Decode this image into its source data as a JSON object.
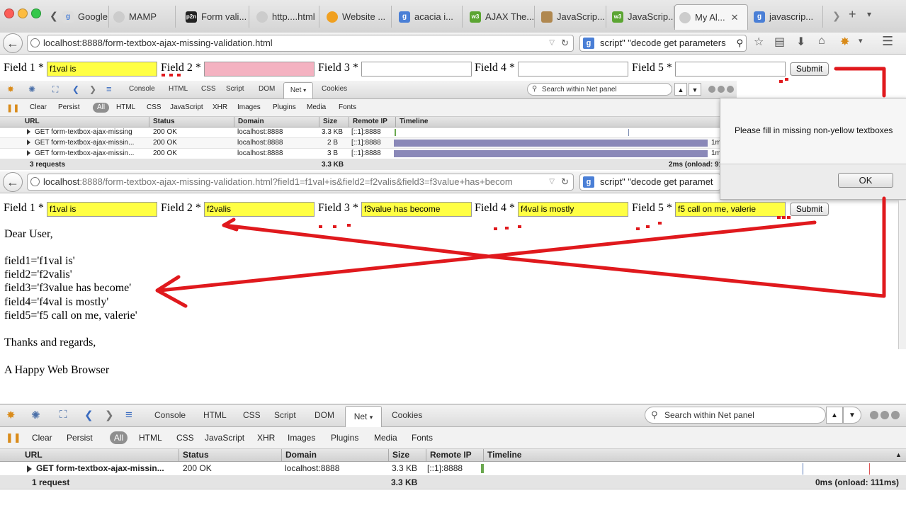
{
  "colors": {
    "yellow": "#ffff44",
    "pink": "#f4b2c1",
    "annotation_red": "#e0191d",
    "timeline_bar": "#8a88b8"
  },
  "tabs": [
    {
      "label": "Google T...",
      "icon": "google-icon"
    },
    {
      "label": "MAMP",
      "icon": "globe-icon"
    },
    {
      "label": "Form vali...",
      "icon": "p2n-icon"
    },
    {
      "label": "http....html",
      "icon": "globe-icon"
    },
    {
      "label": "Website ...",
      "icon": "sun-icon"
    },
    {
      "label": "acacia i...",
      "icon": "google-icon"
    },
    {
      "label": "AJAX The...",
      "icon": "w3-icon"
    },
    {
      "label": "JavaScrip...",
      "icon": "javascript-icon"
    },
    {
      "label": "JavaScrip...",
      "icon": "w3-icon"
    },
    {
      "label": "My Al...",
      "icon": "globe-icon"
    },
    {
      "label": "javascrip...",
      "icon": "google-icon"
    }
  ],
  "tab_bar": {
    "p2n": "p2n",
    "w3": "w3",
    "g": "g",
    "close": "✕",
    "scroll_right": "❯",
    "new_tab": "+",
    "menu": "▾",
    "scroll_left": "❮"
  },
  "nav": {
    "url": "localhost:8888/form-textbox-ajax-missing-validation.html",
    "search": "script\" \"decode get parameters",
    "search_engine": "g",
    "icons": [
      "star-icon",
      "reading-list-icon",
      "download-icon",
      "home-icon",
      "firebug-icon",
      "menu-icon"
    ]
  },
  "inner_nav": {
    "url_host": "localhost",
    "url_rest": ":8888/form-textbox-ajax-missing-validation.html?field1=f1val+is&field2=f2valis&field3=f3value+has+becom",
    "search": "script\" \"decode get paramet"
  },
  "form_top": {
    "labels": [
      "Field 1 *",
      "Field 2 *",
      "Field 3 *",
      "Field 4 *",
      "Field 5 *"
    ],
    "values": [
      "f1val is",
      "",
      "",
      "",
      ""
    ],
    "submit": "Submit"
  },
  "form_bottom": {
    "labels": [
      "Field 1 *",
      "Field 2 *",
      "Field 3 *",
      "Field 4 *",
      "Field 5 *"
    ],
    "values": [
      "f1val  is",
      "f2valis",
      "f3value  has  become",
      "f4val  is  mostly",
      "f5  call  on  me,  valerie"
    ],
    "submit": "Submit"
  },
  "alert": {
    "message": "Please fill in missing non-yellow textboxes",
    "ok": "OK"
  },
  "letter": {
    "greeting": "Dear User,",
    "lines": [
      "field1='f1val is'",
      "field2='f2valis'",
      "field3='f3value has become'",
      "field4='f4val is mostly'",
      "field5='f5 call on me, valerie'"
    ],
    "closing": "Thanks and regards,",
    "signature": "A Happy Web Browser"
  },
  "firebug": {
    "panels": [
      "Console",
      "HTML",
      "CSS",
      "Script",
      "DOM",
      "Net",
      "Cookies"
    ],
    "selected_panel": "Net",
    "search_placeholder": "Search within Net panel",
    "filters": [
      "Clear",
      "Persist",
      "All",
      "HTML",
      "CSS",
      "JavaScript",
      "XHR",
      "Images",
      "Plugins",
      "Media",
      "Fonts"
    ],
    "columns": [
      "URL",
      "Status",
      "Domain",
      "Size",
      "Remote IP",
      "Timeline"
    ],
    "small_rows": [
      {
        "url": "GET form-textbox-ajax-missing",
        "status": "200 OK",
        "domain": "localhost:8888",
        "size": "3.3 KB",
        "ip": "[::1]:8888",
        "time": ""
      },
      {
        "url": "GET form-textbox-ajax-missin...",
        "status": "200 OK",
        "domain": "localhost:8888",
        "size": "2 B",
        "ip": "[::1]:8888",
        "time": "1m"
      },
      {
        "url": "GET form-textbox-ajax-missin...",
        "status": "200 OK",
        "domain": "localhost:8888",
        "size": "3 B",
        "ip": "[::1]:8888",
        "time": "1m"
      }
    ],
    "small_footer": {
      "count": "3 requests",
      "size": "3.3 KB",
      "timing": "2ms (onload: 91"
    },
    "rows": [
      {
        "url": "GET form-textbox-ajax-missin...",
        "status": "200 OK",
        "domain": "localhost:8888",
        "size": "3.3 KB",
        "ip": "[::1]:8888"
      }
    ],
    "footer": {
      "count": "1 request",
      "size": "3.3 KB",
      "timing": "0ms (onload: 111ms)"
    },
    "icon_glyphs": {
      "bug": "✸",
      "inspect": "✺",
      "dom": "⛶",
      "back": "❮",
      "forward": "❯",
      "console": "≡",
      "dropdown": "▾",
      "up": "▲",
      "down": "▼",
      "pause": "❚❚",
      "sort": "▲"
    }
  }
}
